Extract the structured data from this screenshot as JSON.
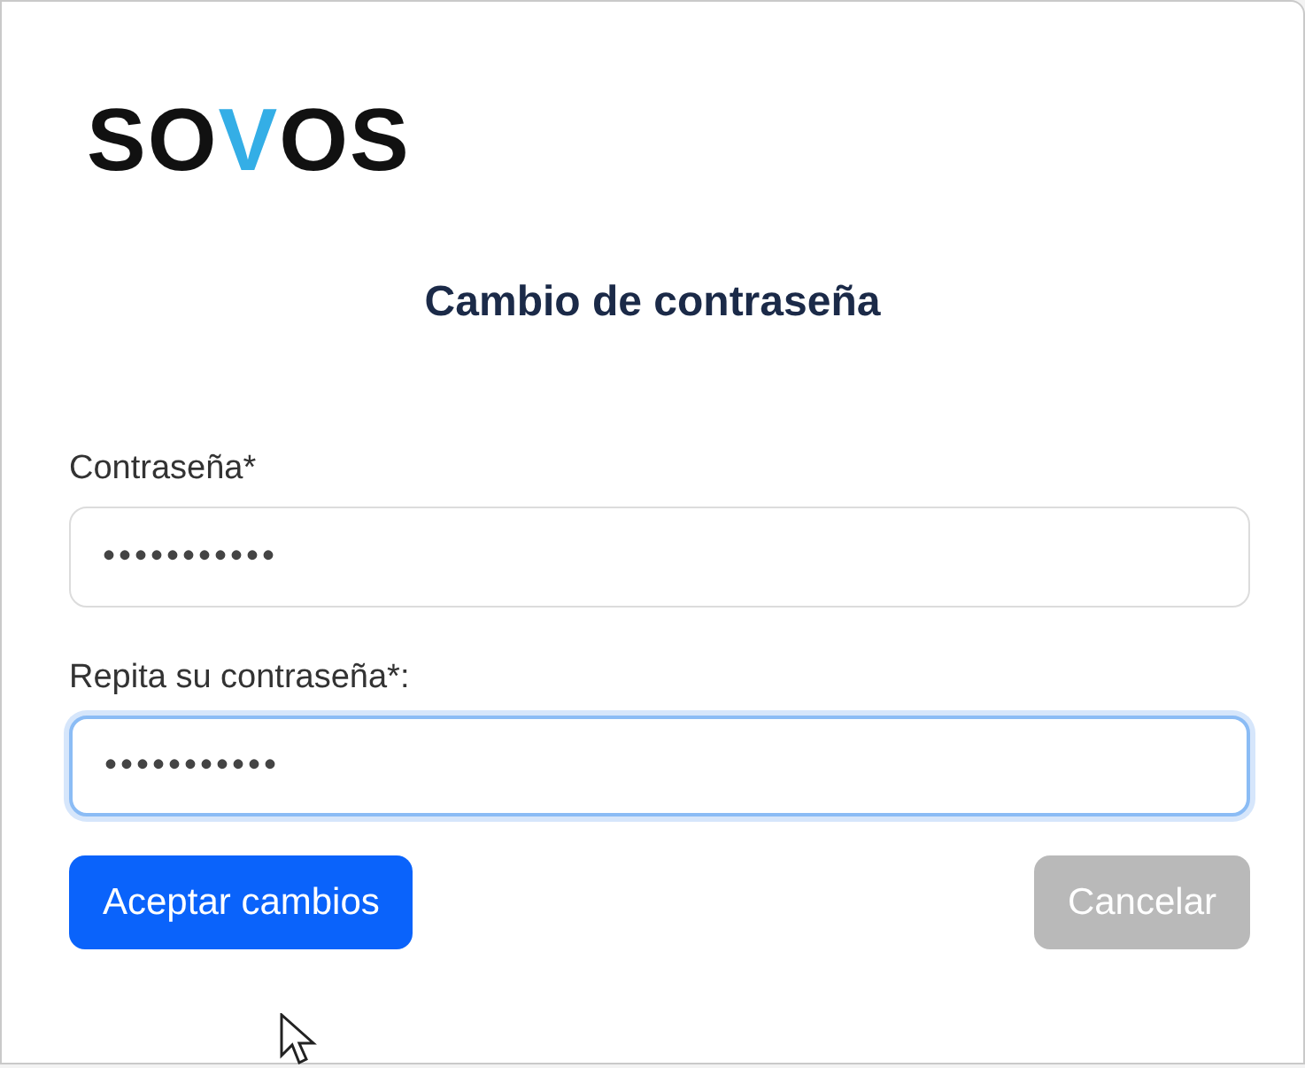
{
  "logo": {
    "text": "SOVOS"
  },
  "title": "Cambio de contraseña",
  "fields": [
    {
      "label": "Contraseña*",
      "value": "•••••••••••",
      "focused": false
    },
    {
      "label": "Repita su contraseña*:",
      "value": "•••••••••••",
      "focused": true
    }
  ],
  "buttons": [
    {
      "label": "Aceptar cambios",
      "kind": "primary",
      "disabled": false
    },
    {
      "label": "Cancelar",
      "kind": "secondary",
      "disabled": true
    }
  ]
}
